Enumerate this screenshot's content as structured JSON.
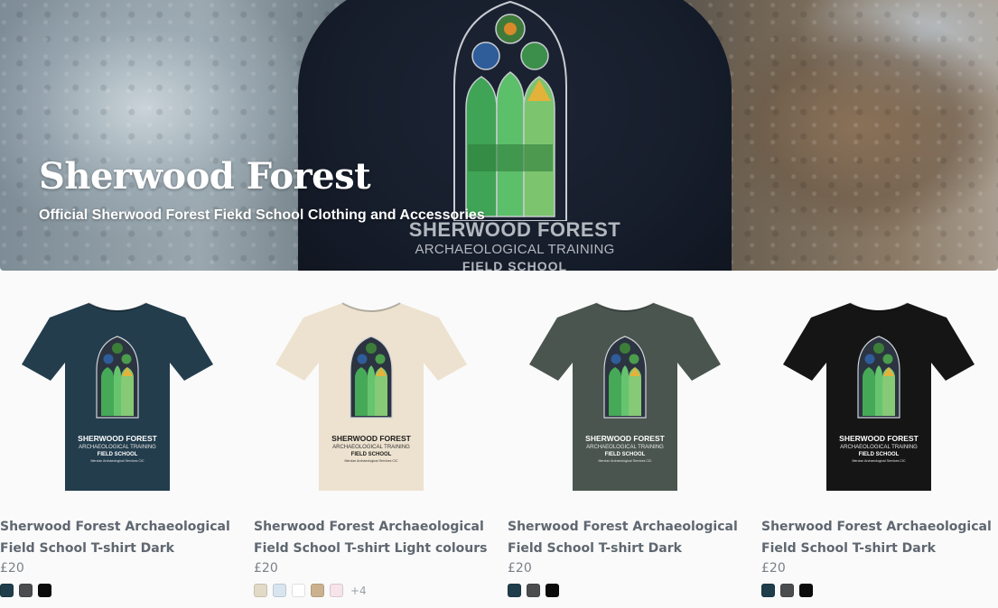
{
  "hero": {
    "title": "Sherwood Forest",
    "subtitle": "Official Sherwood Forest Fiekd School Clothing and Accessories",
    "sweater_print": {
      "line1": "SHERWOOD FOREST",
      "line2": "ARCHAEOLOGICAL TRAINING",
      "line3": "FIELD SCHOOL"
    }
  },
  "shirt_print": {
    "line1": "SHERWOOD FOREST",
    "line2": "ARCHAEOLOGICAL TRAINING",
    "line3": "FIELD SCHOOL",
    "line4": "Mercian Archaeological Services CIC"
  },
  "products": [
    {
      "title_line1": "Sherwood Forest Archaeological",
      "title_line2": "Field School T-shirt Dark",
      "price": "£20",
      "shirt_color": "#233d4d",
      "swatches": [
        "#1f3d4a",
        "#4a4c4e",
        "#0b0b0b"
      ],
      "more": ""
    },
    {
      "title_line1": "Sherwood Forest Archaeological",
      "title_line2": "Field School T-shirt Light colours",
      "price": "£20",
      "shirt_color": "#ede2cf",
      "swatches": [
        "#e2dac6",
        "#d8e4ee",
        "#ffffff",
        "#cbb28e",
        "#f7e3ea"
      ],
      "more": "+4"
    },
    {
      "title_line1": "Sherwood Forest Archaeological",
      "title_line2": "Field School T-shirt Dark",
      "price": "£20",
      "shirt_color": "#4a554f",
      "swatches": [
        "#1f3d4a",
        "#4a4c4e",
        "#0b0b0b"
      ],
      "more": ""
    },
    {
      "title_line1": "Sherwood Forest Archaeological",
      "title_line2": "Field School T-shirt Dark",
      "price": "£20",
      "shirt_color": "#151515",
      "swatches": [
        "#1f3d4a",
        "#4a4c4e",
        "#0b0b0b"
      ],
      "more": ""
    }
  ]
}
